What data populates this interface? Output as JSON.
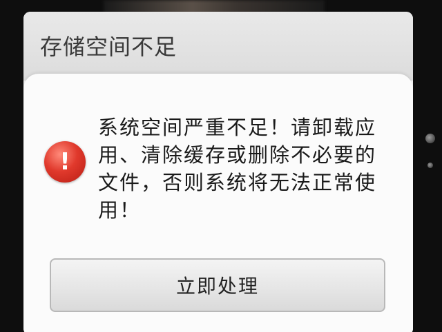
{
  "dialog": {
    "title": "存储空间不足",
    "message": "系统空间严重不足！请卸载应用、清除缓存或删除不必要的文件，否则系统将无法正常使用！",
    "icon": "alert-icon",
    "icon_glyph": "!",
    "action_label": "立即处理"
  },
  "colors": {
    "alert_red": "#e0392c",
    "backdrop": "#0e0e0e",
    "dialog_bg": "#fbfbfb"
  }
}
